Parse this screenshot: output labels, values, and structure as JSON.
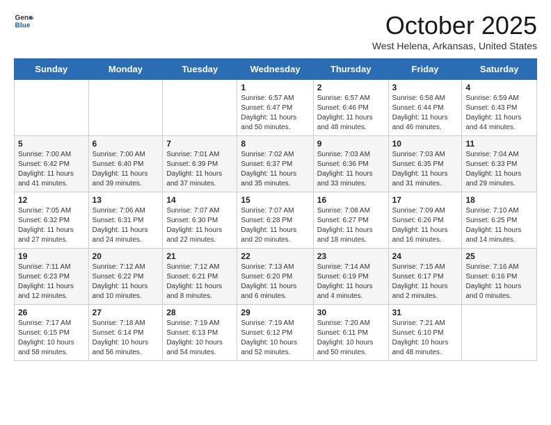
{
  "header": {
    "logo_general": "General",
    "logo_blue": "Blue",
    "month": "October 2025",
    "location": "West Helena, Arkansas, United States"
  },
  "days_of_week": [
    "Sunday",
    "Monday",
    "Tuesday",
    "Wednesday",
    "Thursday",
    "Friday",
    "Saturday"
  ],
  "weeks": [
    [
      {
        "date": "",
        "text": ""
      },
      {
        "date": "",
        "text": ""
      },
      {
        "date": "",
        "text": ""
      },
      {
        "date": "1",
        "text": "Sunrise: 6:57 AM\nSunset: 6:47 PM\nDaylight: 11 hours and 50 minutes."
      },
      {
        "date": "2",
        "text": "Sunrise: 6:57 AM\nSunset: 6:46 PM\nDaylight: 11 hours and 48 minutes."
      },
      {
        "date": "3",
        "text": "Sunrise: 6:58 AM\nSunset: 6:44 PM\nDaylight: 11 hours and 46 minutes."
      },
      {
        "date": "4",
        "text": "Sunrise: 6:59 AM\nSunset: 6:43 PM\nDaylight: 11 hours and 44 minutes."
      }
    ],
    [
      {
        "date": "5",
        "text": "Sunrise: 7:00 AM\nSunset: 6:42 PM\nDaylight: 11 hours and 41 minutes."
      },
      {
        "date": "6",
        "text": "Sunrise: 7:00 AM\nSunset: 6:40 PM\nDaylight: 11 hours and 39 minutes."
      },
      {
        "date": "7",
        "text": "Sunrise: 7:01 AM\nSunset: 6:39 PM\nDaylight: 11 hours and 37 minutes."
      },
      {
        "date": "8",
        "text": "Sunrise: 7:02 AM\nSunset: 6:37 PM\nDaylight: 11 hours and 35 minutes."
      },
      {
        "date": "9",
        "text": "Sunrise: 7:03 AM\nSunset: 6:36 PM\nDaylight: 11 hours and 33 minutes."
      },
      {
        "date": "10",
        "text": "Sunrise: 7:03 AM\nSunset: 6:35 PM\nDaylight: 11 hours and 31 minutes."
      },
      {
        "date": "11",
        "text": "Sunrise: 7:04 AM\nSunset: 6:33 PM\nDaylight: 11 hours and 29 minutes."
      }
    ],
    [
      {
        "date": "12",
        "text": "Sunrise: 7:05 AM\nSunset: 6:32 PM\nDaylight: 11 hours and 27 minutes."
      },
      {
        "date": "13",
        "text": "Sunrise: 7:06 AM\nSunset: 6:31 PM\nDaylight: 11 hours and 24 minutes."
      },
      {
        "date": "14",
        "text": "Sunrise: 7:07 AM\nSunset: 6:30 PM\nDaylight: 11 hours and 22 minutes."
      },
      {
        "date": "15",
        "text": "Sunrise: 7:07 AM\nSunset: 6:28 PM\nDaylight: 11 hours and 20 minutes."
      },
      {
        "date": "16",
        "text": "Sunrise: 7:08 AM\nSunset: 6:27 PM\nDaylight: 11 hours and 18 minutes."
      },
      {
        "date": "17",
        "text": "Sunrise: 7:09 AM\nSunset: 6:26 PM\nDaylight: 11 hours and 16 minutes."
      },
      {
        "date": "18",
        "text": "Sunrise: 7:10 AM\nSunset: 6:25 PM\nDaylight: 11 hours and 14 minutes."
      }
    ],
    [
      {
        "date": "19",
        "text": "Sunrise: 7:11 AM\nSunset: 6:23 PM\nDaylight: 11 hours and 12 minutes."
      },
      {
        "date": "20",
        "text": "Sunrise: 7:12 AM\nSunset: 6:22 PM\nDaylight: 11 hours and 10 minutes."
      },
      {
        "date": "21",
        "text": "Sunrise: 7:12 AM\nSunset: 6:21 PM\nDaylight: 11 hours and 8 minutes."
      },
      {
        "date": "22",
        "text": "Sunrise: 7:13 AM\nSunset: 6:20 PM\nDaylight: 11 hours and 6 minutes."
      },
      {
        "date": "23",
        "text": "Sunrise: 7:14 AM\nSunset: 6:19 PM\nDaylight: 11 hours and 4 minutes."
      },
      {
        "date": "24",
        "text": "Sunrise: 7:15 AM\nSunset: 6:17 PM\nDaylight: 11 hours and 2 minutes."
      },
      {
        "date": "25",
        "text": "Sunrise: 7:16 AM\nSunset: 6:16 PM\nDaylight: 11 hours and 0 minutes."
      }
    ],
    [
      {
        "date": "26",
        "text": "Sunrise: 7:17 AM\nSunset: 6:15 PM\nDaylight: 10 hours and 58 minutes."
      },
      {
        "date": "27",
        "text": "Sunrise: 7:18 AM\nSunset: 6:14 PM\nDaylight: 10 hours and 56 minutes."
      },
      {
        "date": "28",
        "text": "Sunrise: 7:19 AM\nSunset: 6:13 PM\nDaylight: 10 hours and 54 minutes."
      },
      {
        "date": "29",
        "text": "Sunrise: 7:19 AM\nSunset: 6:12 PM\nDaylight: 10 hours and 52 minutes."
      },
      {
        "date": "30",
        "text": "Sunrise: 7:20 AM\nSunset: 6:11 PM\nDaylight: 10 hours and 50 minutes."
      },
      {
        "date": "31",
        "text": "Sunrise: 7:21 AM\nSunset: 6:10 PM\nDaylight: 10 hours and 48 minutes."
      },
      {
        "date": "",
        "text": ""
      }
    ]
  ]
}
